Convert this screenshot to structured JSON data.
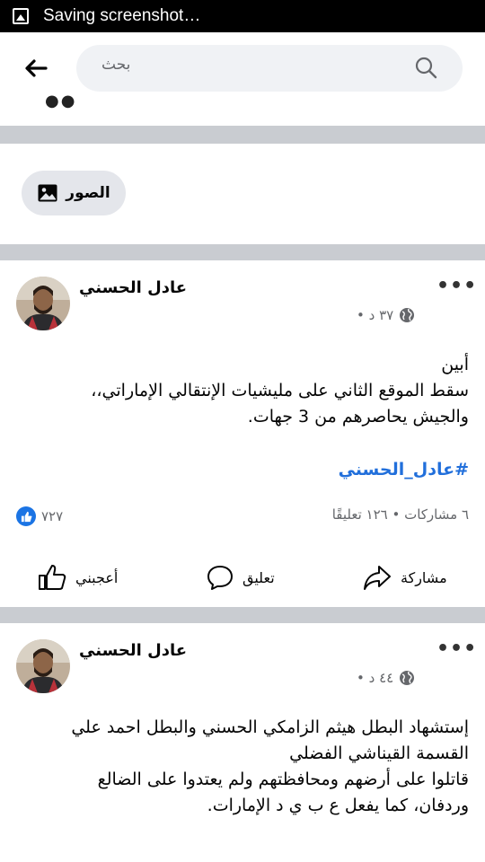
{
  "status_bar": {
    "text": "Saving screenshot…"
  },
  "search": {
    "placeholder": "بحث"
  },
  "filters": {
    "photos_label": "الصور"
  },
  "posts": [
    {
      "author": "عادل الحسني",
      "meta_time": "٣٧ د •",
      "body_lines": [
        "أبين",
        "سقط الموقع الثاني على مليشيات الإنتقالي الإماراتي،،",
        "والجيش يحاصرهم من 3 جهات."
      ],
      "hashtag": "#عادل_الحسني",
      "likes": "٧٢٧",
      "stats": "٦ مشاركات • ١٢٦ تعليقًا",
      "actions": {
        "like": "أعجبني",
        "comment": "تعليق",
        "share": "مشاركة"
      }
    },
    {
      "author": "عادل الحسني",
      "meta_time": "٤٤ د •",
      "body_lines": [
        "إستشهاد  البطل هيثم الزامكي الحسني والبطل  احمد علي",
        "القسمة القيناشي الفضلي",
        "قاتلوا على أرضهم ومحافظتهم ولم يعتدوا على الضالع",
        "وردفان، كما يفعل ع ب ي د الإمارات."
      ]
    }
  ],
  "colors": {
    "accent": "#1b74e4",
    "hashtag": "#216fdb",
    "divider": "#c9ccd1"
  },
  "icons": [
    "image-icon",
    "back-arrow-icon",
    "search-icon",
    "globe-icon",
    "more-icon",
    "like-icon",
    "comment-icon",
    "share-icon"
  ]
}
